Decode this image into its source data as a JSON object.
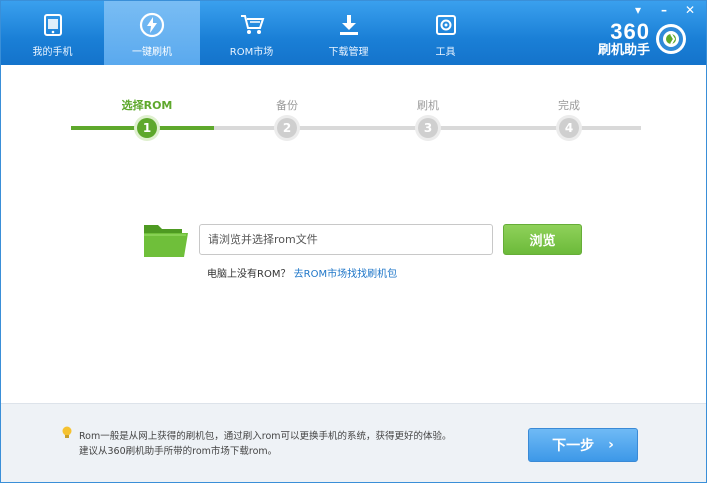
{
  "nav": {
    "items": [
      {
        "label": "我的手机",
        "icon": "phone-icon"
      },
      {
        "label": "一键刷机",
        "icon": "flash-icon",
        "active": true
      },
      {
        "label": "ROM市场",
        "icon": "cart-icon"
      },
      {
        "label": "下载管理",
        "icon": "download-icon"
      },
      {
        "label": "工具",
        "icon": "toolbox-icon"
      }
    ]
  },
  "window_controls": {
    "menu": "▾",
    "minimize": "–",
    "close": "✕"
  },
  "brand": {
    "number": "360",
    "subtitle": "刷机助手"
  },
  "steps": [
    {
      "label": "选择ROM",
      "number": "1",
      "active": true
    },
    {
      "label": "备份",
      "number": "2"
    },
    {
      "label": "刷机",
      "number": "3"
    },
    {
      "label": "完成",
      "number": "4"
    }
  ],
  "file_picker": {
    "placeholder": "请浏览并选择rom文件",
    "browse_label": "浏览",
    "hint_text": "电脑上没有ROM？",
    "hint_link": "去ROM市场找找刷机包"
  },
  "footer": {
    "tip_line1": "Rom一般是从网上获得的刷机包，通过刷入rom可以更换手机的系统，获得更好的体验。",
    "tip_line2": "建议从360刷机助手所带的rom市场下载rom。",
    "next_label": "下一步",
    "next_arrow": "›"
  },
  "colors": {
    "header_blue": "#1a7fd6",
    "active_green": "#5ea82c",
    "next_blue": "#3d98e8"
  }
}
